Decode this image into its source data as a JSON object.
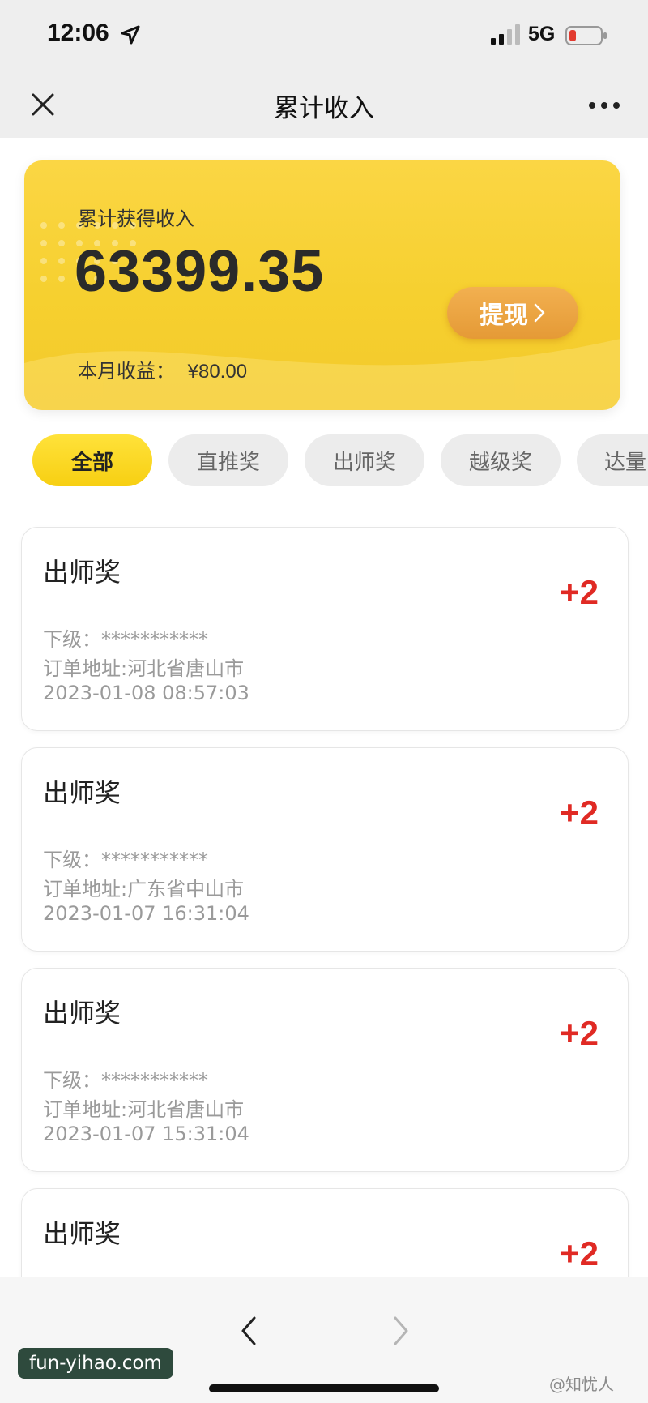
{
  "status_bar": {
    "time": "12:06",
    "network": "5G",
    "icons": [
      "location-arrow-icon",
      "signal-icon",
      "battery-low-icon"
    ]
  },
  "nav": {
    "title": "累计收入",
    "close_icon": "close-icon",
    "more_icon": "more-icon"
  },
  "income_card": {
    "label": "累计获得收入",
    "total": "63399.35",
    "month_label": "本月收益：",
    "month_value": "¥80.00",
    "withdraw_label": "提现"
  },
  "tabs": [
    {
      "label": "全部",
      "active": true
    },
    {
      "label": "直推奖",
      "active": false
    },
    {
      "label": "出师奖",
      "active": false
    },
    {
      "label": "越级奖",
      "active": false
    },
    {
      "label": "达量",
      "active": false
    }
  ],
  "records": [
    {
      "title": "出师奖",
      "amount": "+2",
      "sub_label": "下级：",
      "sub_value": "***********",
      "address_label": "订单地址:",
      "address": "河北省唐山市",
      "time": "2023-01-08 08:57:03"
    },
    {
      "title": "出师奖",
      "amount": "+2",
      "sub_label": "下级：",
      "sub_value": "***********",
      "address_label": "订单地址:",
      "address": "广东省中山市",
      "time": "2023-01-07 16:31:04"
    },
    {
      "title": "出师奖",
      "amount": "+2",
      "sub_label": "下级：",
      "sub_value": "***********",
      "address_label": "订单地址:",
      "address": "河北省唐山市",
      "time": "2023-01-07 15:31:04"
    },
    {
      "title": "出师奖",
      "amount": "+2"
    }
  ],
  "toolbar": {
    "back_icon": "chevron-left-icon",
    "forward_icon": "chevron-right-icon"
  },
  "watermarks": {
    "left": "fun-yihao.com",
    "right": "@知忧人"
  },
  "colors": {
    "card_yellow": "#f6d02f",
    "withdraw_orange": "#e9a13e",
    "amount_red": "#e02a24",
    "active_tab": "#f7cf12"
  }
}
